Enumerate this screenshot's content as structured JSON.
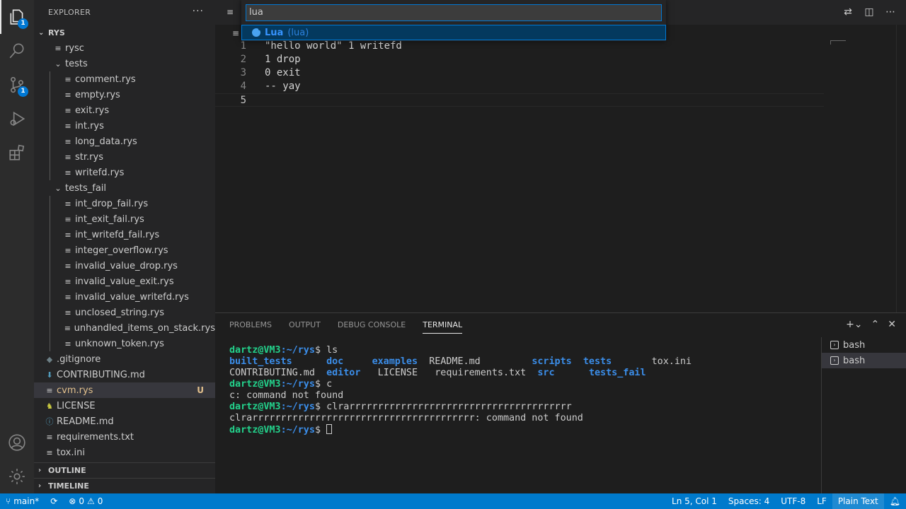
{
  "explorer": {
    "title": "EXPLORER",
    "more": "···"
  },
  "workspace": {
    "name": "RYS"
  },
  "activity": {
    "explorer_badge": "1",
    "scm_badge": "1"
  },
  "tree": [
    {
      "label": "rysc",
      "depth": 1,
      "kind": "file",
      "icon": "≡"
    },
    {
      "label": "tests",
      "depth": 1,
      "kind": "folder",
      "icon": "⌄"
    },
    {
      "label": "comment.rys",
      "depth": 2,
      "kind": "file",
      "icon": "≡"
    },
    {
      "label": "empty.rys",
      "depth": 2,
      "kind": "file",
      "icon": "≡"
    },
    {
      "label": "exit.rys",
      "depth": 2,
      "kind": "file",
      "icon": "≡"
    },
    {
      "label": "int.rys",
      "depth": 2,
      "kind": "file",
      "icon": "≡"
    },
    {
      "label": "long_data.rys",
      "depth": 2,
      "kind": "file",
      "icon": "≡"
    },
    {
      "label": "str.rys",
      "depth": 2,
      "kind": "file",
      "icon": "≡"
    },
    {
      "label": "writefd.rys",
      "depth": 2,
      "kind": "file",
      "icon": "≡"
    },
    {
      "label": "tests_fail",
      "depth": 1,
      "kind": "folder",
      "icon": "⌄"
    },
    {
      "label": "int_drop_fail.rys",
      "depth": 2,
      "kind": "file",
      "icon": "≡"
    },
    {
      "label": "int_exit_fail.rys",
      "depth": 2,
      "kind": "file",
      "icon": "≡"
    },
    {
      "label": "int_writefd_fail.rys",
      "depth": 2,
      "kind": "file",
      "icon": "≡"
    },
    {
      "label": "integer_overflow.rys",
      "depth": 2,
      "kind": "file",
      "icon": "≡"
    },
    {
      "label": "invalid_value_drop.rys",
      "depth": 2,
      "kind": "file",
      "icon": "≡"
    },
    {
      "label": "invalid_value_exit.rys",
      "depth": 2,
      "kind": "file",
      "icon": "≡"
    },
    {
      "label": "invalid_value_writefd.rys",
      "depth": 2,
      "kind": "file",
      "icon": "≡"
    },
    {
      "label": "unclosed_string.rys",
      "depth": 2,
      "kind": "file",
      "icon": "≡"
    },
    {
      "label": "unhandled_items_on_stack.rys",
      "depth": 2,
      "kind": "file",
      "icon": "≡"
    },
    {
      "label": "unknown_token.rys",
      "depth": 2,
      "kind": "file",
      "icon": "≡"
    },
    {
      "label": ".gitignore",
      "depth": 0,
      "kind": "file",
      "icon": "◆"
    },
    {
      "label": "CONTRIBUTING.md",
      "depth": 0,
      "kind": "file",
      "icon": "⬇"
    },
    {
      "label": "cvm.rys",
      "depth": 0,
      "kind": "file",
      "icon": "≡",
      "selected": true,
      "badge": "U"
    },
    {
      "label": "LICENSE",
      "depth": 0,
      "kind": "file",
      "icon": "♞"
    },
    {
      "label": "README.md",
      "depth": 0,
      "kind": "file",
      "icon": "ⓘ"
    },
    {
      "label": "requirements.txt",
      "depth": 0,
      "kind": "file",
      "icon": "≡"
    },
    {
      "label": "tox.ini",
      "depth": 0,
      "kind": "file",
      "icon": "≡"
    }
  ],
  "sections": {
    "outline": "OUTLINE",
    "timeline": "TIMELINE"
  },
  "quickpick": {
    "value": "lua",
    "items": [
      {
        "label": "Lua",
        "description": "(lua)"
      }
    ]
  },
  "code": {
    "lines": [
      {
        "num": "1",
        "text": "\"hello world\" 1 writefd"
      },
      {
        "num": "2",
        "text": "1 drop"
      },
      {
        "num": "3",
        "text": "0 exit"
      },
      {
        "num": "4",
        "text": "-- yay"
      },
      {
        "num": "5",
        "text": ""
      }
    ]
  },
  "panel": {
    "tabs": [
      "PROBLEMS",
      "OUTPUT",
      "DEBUG CONSOLE",
      "TERMINAL"
    ],
    "active_tab": "TERMINAL",
    "terminals": [
      "bash",
      "bash"
    ]
  },
  "terminal": {
    "prompt_user": "dartz@VM3",
    "prompt_path": ":~/rys",
    "prompt_end": "$ ",
    "cmd1": "ls",
    "ls_row1": [
      "built_tests",
      "doc",
      "examples",
      "README.md",
      "scripts",
      "tests",
      "tox.ini"
    ],
    "ls_row2": [
      "CONTRIBUTING.md",
      "editor",
      "LICENSE",
      "requirements.txt",
      "src",
      "tests_fail"
    ],
    "cmd2": "c",
    "out2": "c: command not found",
    "cmd3": "clrarrrrrrrrrrrrrrrrrrrrrrrrrrrrrrrrrrrrrrr",
    "out3": "clrarrrrrrrrrrrrrrrrrrrrrrrrrrrrrrrrrrrrrrr: command not found"
  },
  "status": {
    "branch": "main*",
    "errors": "0",
    "warnings": "0",
    "position": "Ln 5, Col 1",
    "spaces": "Spaces: 4",
    "encoding": "UTF-8",
    "eol": "LF",
    "language": "Plain Text"
  },
  "colors": {
    "accent": "#007acc",
    "untracked": "#e2c08d",
    "term_green": "#23d18b",
    "term_blue": "#3b8eea"
  }
}
